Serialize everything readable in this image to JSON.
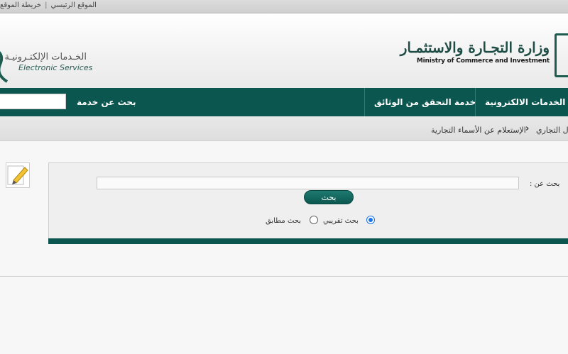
{
  "topbar": {
    "home_link": "الموقع الرئيسي",
    "separator": "|",
    "sitemap_link": "خريطة الموقع"
  },
  "header": {
    "ministry_name_ar": "وزارة التجـارة والاستثمـار",
    "ministry_name_en": "Ministry of Commerce and Investment",
    "eservices_ar": "الخـدمات الإلكتـرونيـة",
    "eservices_en": "Electronic Services"
  },
  "nav": {
    "items": [
      {
        "label": "الخدمات الالكترونية"
      },
      {
        "label": "خدمة التحقق من الوثائق"
      }
    ],
    "search_label": "بحث عن خدمة",
    "search_value": ""
  },
  "breadcrumb": {
    "parent": "ل التجاري",
    "current": "الإستعلام عن الأسماء التجارية"
  },
  "search_form": {
    "label": "بحث عن :",
    "query_value": "",
    "button_label": "بحث",
    "options": [
      {
        "label": "بحث تقريبي",
        "checked": true
      },
      {
        "label": "بحث مطابق",
        "checked": false
      }
    ]
  },
  "colors": {
    "brand_green": "#0b5750",
    "radio_accent": "#1a73e8"
  }
}
